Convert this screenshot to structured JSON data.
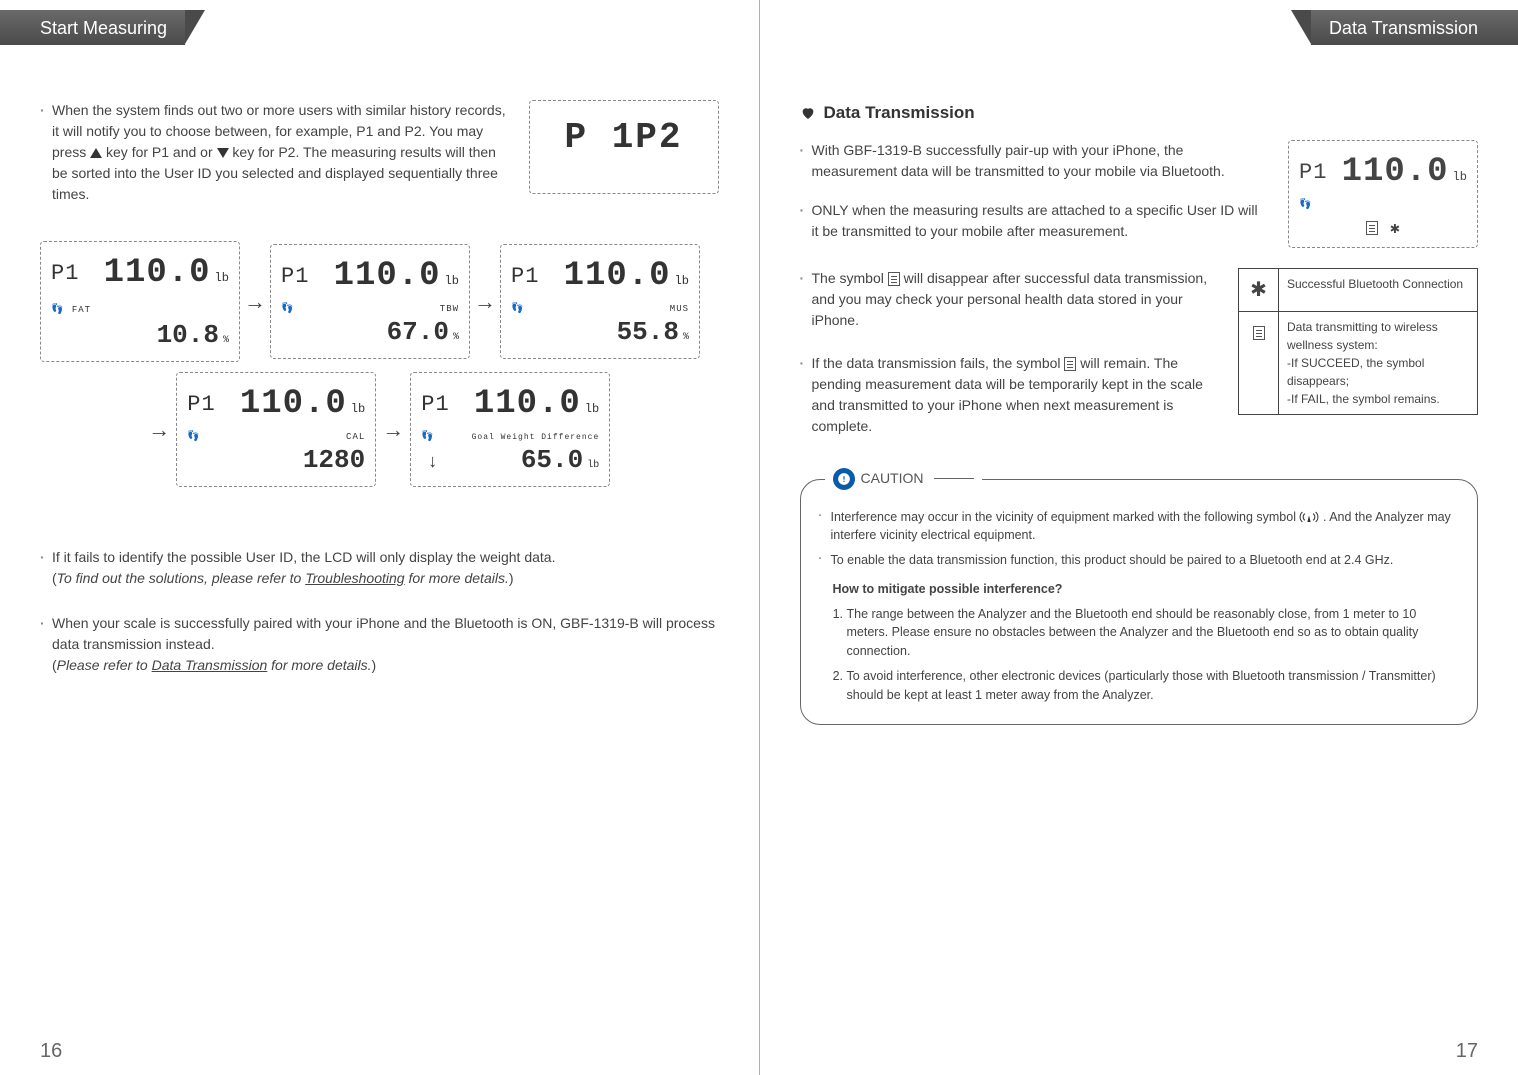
{
  "left": {
    "header": "Start Measuring",
    "para1": "When the system finds out two or more users with similar history records, it will notify you to choose between, for example, P1 and P2. You may press ▲ key for P1 and or ▼ key for P2. The measuring results will then be sorted into the User ID you selected and displayed sequentially three times.",
    "lcd_select": "P 1P2",
    "screens": [
      {
        "pid": "P1",
        "weight": "110.0",
        "unit": "lb",
        "metric_lbl": "FAT",
        "metric_val": "10.8",
        "suffix": "%"
      },
      {
        "pid": "P1",
        "weight": "110.0",
        "unit": "lb",
        "metric_lbl": "TBW",
        "metric_val": "67.0",
        "suffix": "%"
      },
      {
        "pid": "P1",
        "weight": "110.0",
        "unit": "lb",
        "metric_lbl": "MUS",
        "metric_val": "55.8",
        "suffix": "%"
      },
      {
        "pid": "P1",
        "weight": "110.0",
        "unit": "lb",
        "metric_lbl": "CAL",
        "metric_val": "1280",
        "suffix": ""
      },
      {
        "pid": "P1",
        "weight": "110.0",
        "unit": "lb",
        "metric_lbl": "Goal Weight Difference",
        "metric_val": "65.0",
        "suffix": "lb",
        "extra_left": "↓"
      }
    ],
    "fail_note": "If it fails to identify the possible User ID, the LCD will only display the weight data.",
    "fail_ref_pre": "(",
    "fail_ref_italic": "To find out the solutions, please refer to ",
    "fail_ref_link": "Troubleshooting",
    "fail_ref_post_italic": " for more details.",
    "fail_ref_post": ")",
    "paired_note": "When your scale is successfully paired with your iPhone and the Bluetooth is ON, GBF-1319-B will process data transmission instead.",
    "paired_ref_pre": "(",
    "paired_ref_italic": "Please refer to ",
    "paired_ref_link": "Data Transmission",
    "paired_ref_post_italic": " for more details.",
    "paired_ref_post": ")",
    "page_num": "16"
  },
  "right": {
    "header": "Data Transmission",
    "heading": "Data Transmission",
    "bullets": [
      "With GBF-1319-B successfully pair-up with your iPhone, the measurement data will be transmitted to your mobile via Bluetooth.",
      "ONLY when the measuring results are attached to a specific User ID will it be transmitted to your mobile after measurement.",
      "The symbol 🗎 will disappear after successful data transmission, and you may check your personal health data stored in your iPhone.",
      "If the data transmission fails, the symbol 🗎 will remain. The pending measurement data will be temporarily kept in the scale and transmitted to your iPhone when next measurement is complete."
    ],
    "lcd": {
      "pid": "P1",
      "weight": "110.0",
      "unit": "lb",
      "foot": "🗎",
      "bt": "✱"
    },
    "symbol_table": [
      {
        "icon": "✱",
        "desc": "Successful Bluetooth Connection"
      },
      {
        "icon": "🗎",
        "desc": "Data transmitting to wireless wellness system:\n-If SUCCEED, the symbol disappears;\n-If FAIL, the symbol remains."
      }
    ],
    "caution": {
      "label": "CAUTION",
      "c1a": "Interference may occur in the vicinity of equipment marked with the following symbol ",
      "c1b": ". And the Analyzer may interfere vicinity electrical equipment.",
      "c2": "To enable the data transmission function, this product should be paired to a Bluetooth end at 2.4 GHz.",
      "sub": "How to mitigate possible interference?",
      "steps": [
        "The range between the Analyzer and the Bluetooth end should be reasonably close, from 1 meter to 10 meters. Please ensure no obstacles between the Analyzer and the Bluetooth end so as to obtain quality connection.",
        "To avoid interference, other electronic devices (particularly those with Bluetooth transmission / Transmitter) should be kept at least 1 meter away from the Analyzer."
      ]
    },
    "page_num": "17"
  }
}
